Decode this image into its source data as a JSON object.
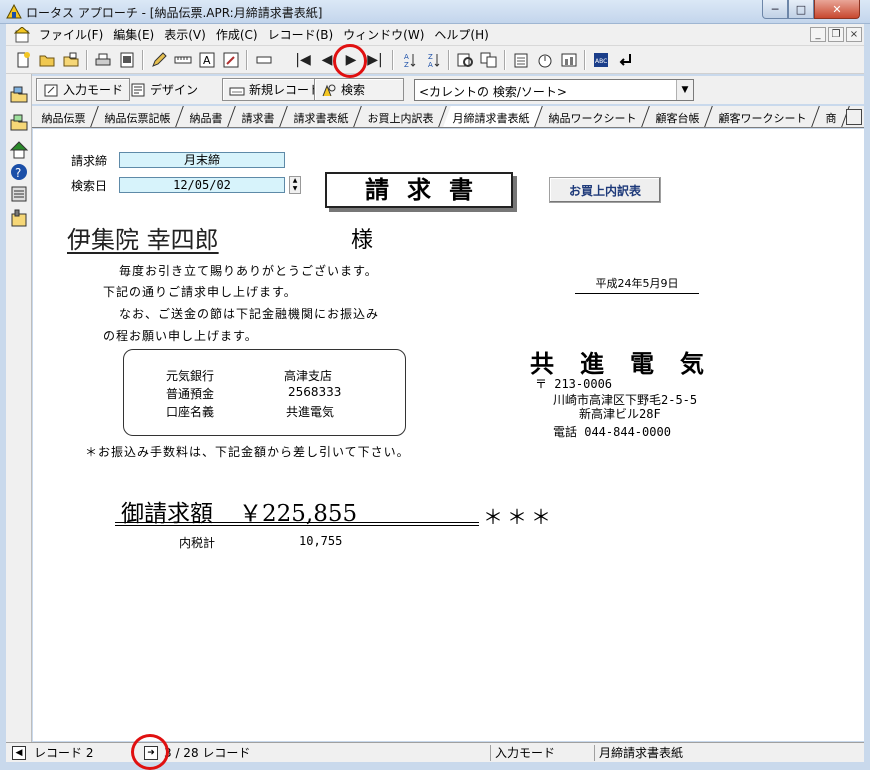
{
  "window": {
    "title": "ロータス アプローチ - [納品伝票.APR:月締請求書表紙]",
    "min_glyph": "─",
    "max_glyph": "□",
    "close_glyph": "✕"
  },
  "menu": {
    "items": [
      "ファイル(F)",
      "編集(E)",
      "表示(V)",
      "作成(C)",
      "レコード(B)",
      "ウィンドウ(W)",
      "ヘルプ(H)"
    ],
    "mdi_min": "_",
    "mdi_restore": "❐",
    "mdi_close": "×"
  },
  "toolbar": {
    "first_record": "|◀",
    "prev_record": "◀",
    "next_record": "▶",
    "last_record": "▶|"
  },
  "toolbar2": {
    "input_mode": "入力モード",
    "design": "デザイン",
    "new_record": "新規レコード",
    "search": "検索",
    "search_combo": "<カレントの 検索/ソート>"
  },
  "tabs": [
    "納品伝票",
    "納品伝票記帳",
    "納品書",
    "請求書",
    "請求書表紙",
    "お買上内訳表",
    "月締請求書表紙",
    "納品ワークシート",
    "顧客台帳",
    "顧客ワークシート",
    "商"
  ],
  "form": {
    "billing_close_label": "請求締",
    "billing_close_value": "月末締",
    "search_date_label": "検索日",
    "search_date_value": "12/05/02",
    "doc_title": "請求書",
    "purchase_detail_button": "お買上内訳表",
    "customer_name": "伊集院 幸四郎",
    "honorific": "様",
    "message_lines": [
      "毎度お引き立て賜りありがとうございます。",
      "下記の通りご請求申し上げます。",
      "なお、ご送金の節は下記金融機関にお振込み",
      "の程お願い申し上げます。"
    ],
    "issue_date": "平成24年5月9日",
    "bank": {
      "rows": [
        [
          "元気銀行",
          "高津支店"
        ],
        [
          "普通預金",
          "2568333"
        ],
        [
          "口座名義",
          "共進電気"
        ]
      ]
    },
    "company": {
      "name": "共進電気",
      "postal": "〒 213-0006",
      "address1": "川崎市高津区下野毛2-5-5",
      "address2": "新高津ビル28F",
      "phone": "電話 044-844-0000"
    },
    "fee_note": "＊お振込み手数料は、下記金額から差し引いて下さい。",
    "billing_label": "御請求額",
    "billing_amount": "￥225,855",
    "stars": "＊＊＊",
    "tax_label": "内税計",
    "tax_value": "10,755"
  },
  "status": {
    "record": "レコード 2",
    "record_of": "3 / 28 レコード",
    "mode": "入力モード",
    "view": "月締請求書表紙"
  },
  "colors": {
    "field_bg": "#d7f3fb",
    "marker": "#e01010",
    "button_text": "#1e3a7a"
  }
}
